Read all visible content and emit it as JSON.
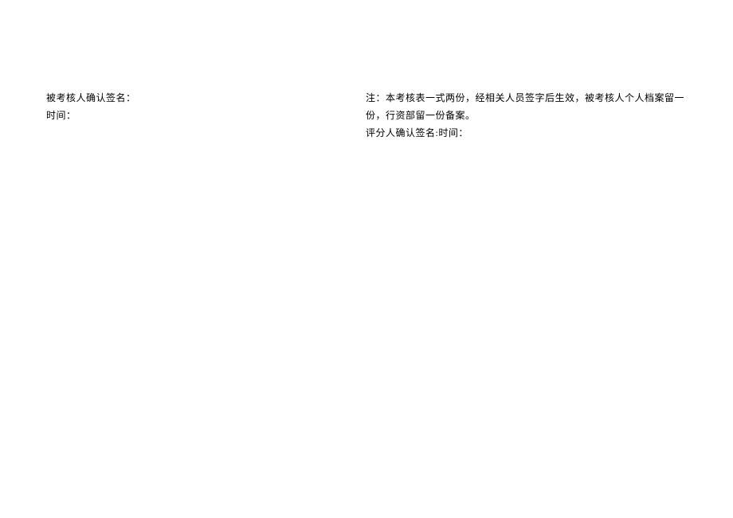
{
  "left": {
    "line1": "被考核人确认签名：",
    "line2": "时间："
  },
  "right": {
    "line1": "注：本考核表一式两份，经相关人员签字后生效，被考核人个人档案留一份，行资部留一份备案。",
    "line2": "评分人确认签名:时间："
  }
}
